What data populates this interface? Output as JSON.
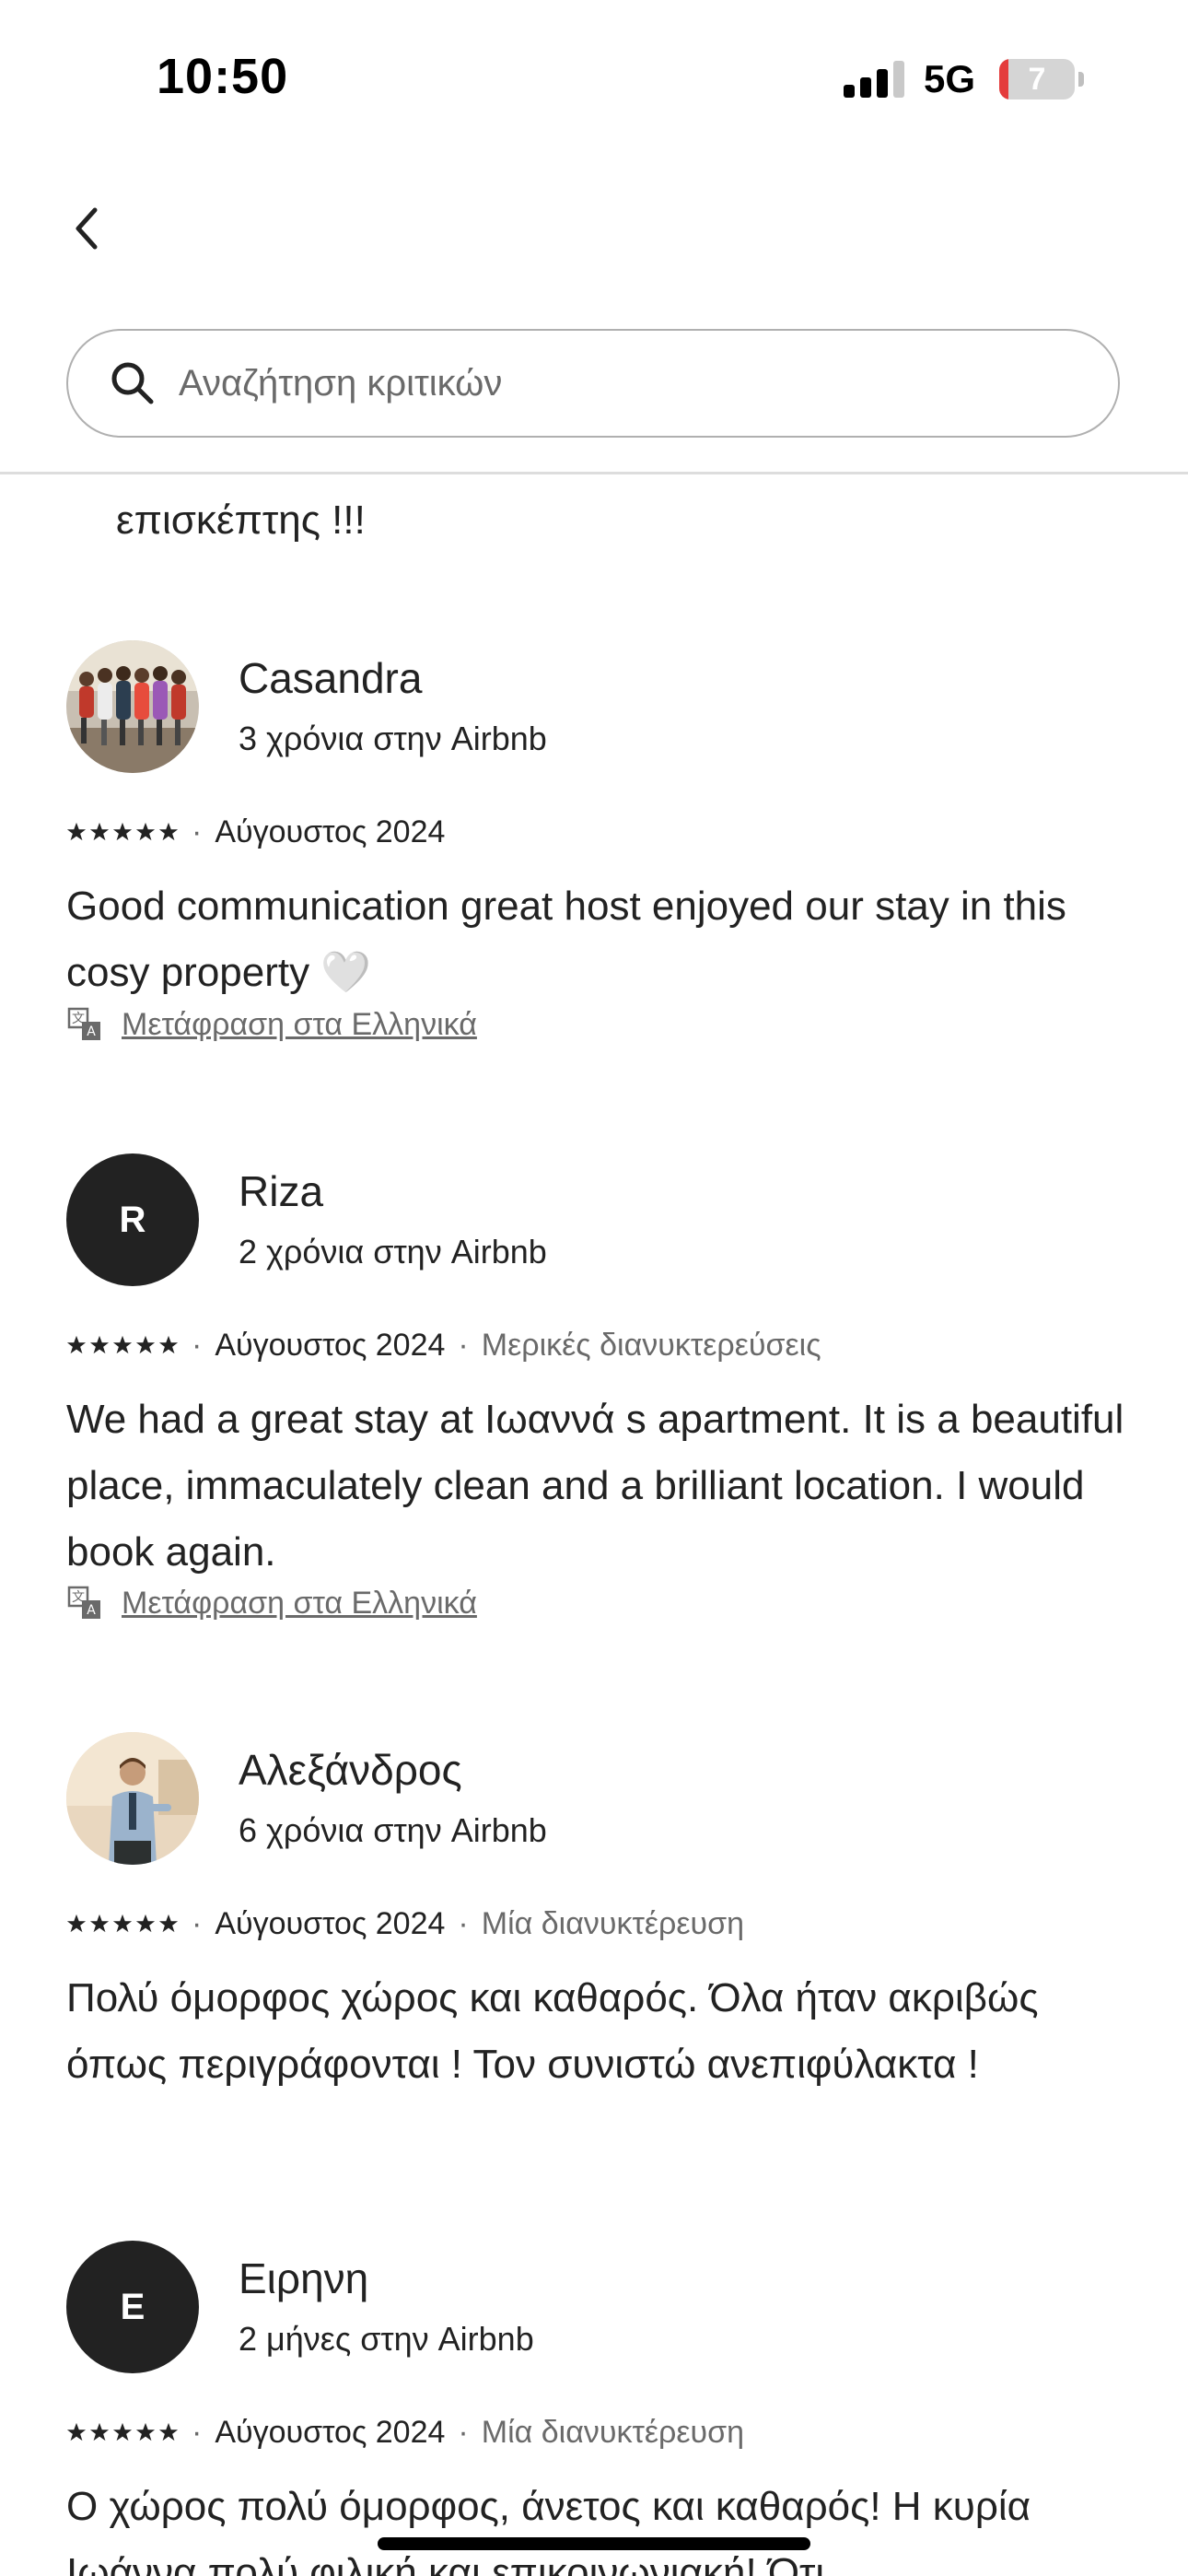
{
  "status_bar": {
    "time": "10:50",
    "network": "5G",
    "battery_level": "7",
    "battery_fraction": 0.07
  },
  "header": {
    "back_icon": "chevron-left-icon",
    "search": {
      "icon": "search-icon",
      "placeholder": "Αναζήτηση κριτικών",
      "value": ""
    }
  },
  "reviews": {
    "previous_text_tail": "επισκέπτης !!!",
    "items": [
      {
        "name": "Casandra",
        "tenure": "3 χρόνια στην Airbnb",
        "avatar": "photo",
        "rating": 5,
        "date": "Αύγουστος 2024",
        "stay": "",
        "text": "Good communication great host enjoyed our stay in this cosy property 🤍",
        "translate_label": "Μετάφραση στα Ελληνικά"
      },
      {
        "name": "Riza",
        "tenure": "2 χρόνια στην Airbnb",
        "avatar": "initial",
        "initial": "R",
        "rating": 5,
        "date": "Αύγουστος 2024",
        "stay": "Μερικές διανυκτερεύσεις",
        "text": "We had a great stay at Ιωαννά s apartment. It is a beautiful place, immaculately clean and a brilliant location. I would book again.",
        "translate_label": "Μετάφραση στα Ελληνικά"
      },
      {
        "name": "Αλεξάνδρος",
        "tenure": "6 χρόνια στην Airbnb",
        "avatar": "photo",
        "rating": 5,
        "date": "Αύγουστος 2024",
        "stay": "Μία διανυκτέρευση",
        "text": "Πολύ όμορφος χώρος και καθαρός. Όλα ήταν ακριβώς όπως περιγράφονται ! Τον συνιστώ ανεπιφύλακτα !"
      },
      {
        "name": "Ειρηνη",
        "tenure": "2 μήνες στην Airbnb",
        "avatar": "initial",
        "initial": "E",
        "rating": 5,
        "date": "Αύγουστος 2024",
        "stay": "Μία διανυκτέρευση",
        "text": "Ο χώρος πολύ όμορφος, άνετος και καθαρός! Η κυρία Ιωάννα πολύ φιλική και επικοινωνιακή! Ότι"
      }
    ],
    "separator": "·"
  },
  "colors": {
    "text_primary": "#222222",
    "text_secondary": "#6a6a6a",
    "avatar_initial_bg": "#222222",
    "battery_low": "#e43c3c"
  }
}
